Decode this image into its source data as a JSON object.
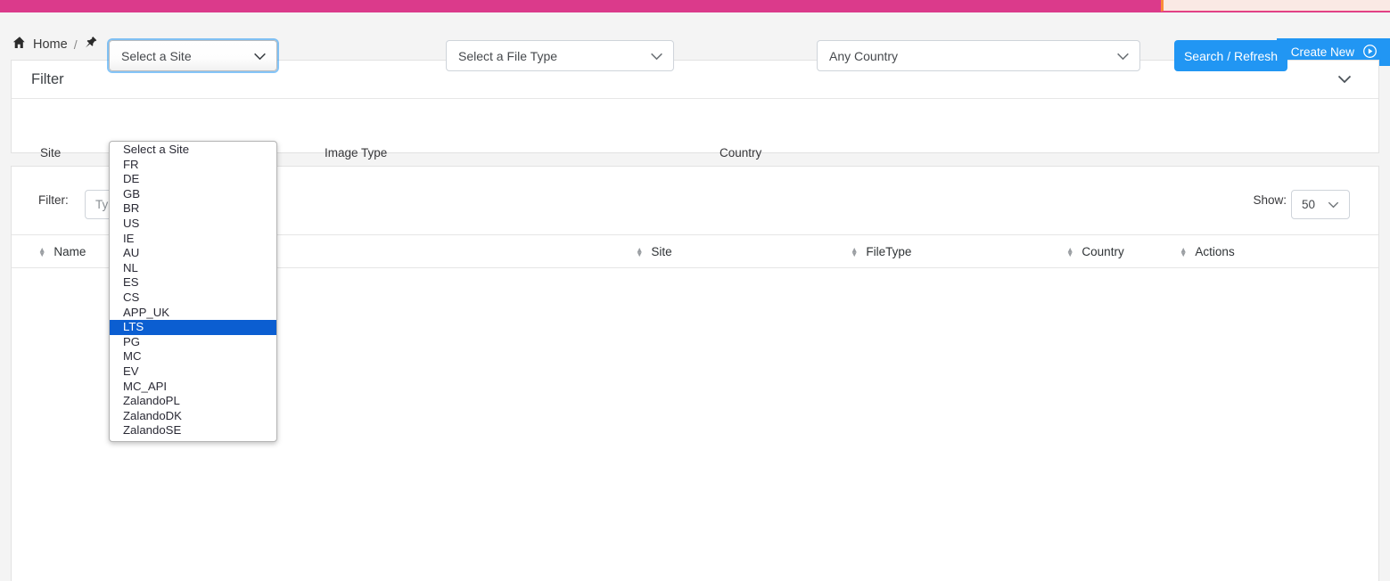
{
  "topbar": {
    "accent_color": "#db3a8b",
    "notice_color": "#fae9e4",
    "notice_border_color": "#fa8c38"
  },
  "breadcrumb": {
    "home_icon": "home-icon",
    "home_label": "Home",
    "separator": "/",
    "pin_icon": "pin-icon"
  },
  "header_actions": {
    "create_new_label": "Create New",
    "create_new_icon": "play-circle-icon",
    "create_new_color": "#2196f3"
  },
  "filter_panel": {
    "title": "Filter",
    "collapse_icon": "chevron-down-icon",
    "fields": {
      "site": {
        "label": "Site",
        "value": "Select a Site",
        "icon": "chevron-down-icon"
      },
      "image_type": {
        "label": "Image Type",
        "value": "Select a File Type",
        "icon": "chevron-down-icon"
      },
      "country": {
        "label": "Country",
        "value": "Any Country",
        "icon": "chevron-down-icon"
      }
    },
    "search_button": {
      "label": "Search / Refresh",
      "color": "#2196f3"
    }
  },
  "site_dropdown": {
    "open": true,
    "highlighted": "LTS",
    "highlight_color": "#0b5ed1",
    "options": [
      "Select a Site",
      "FR",
      "DE",
      "GB",
      "BR",
      "US",
      "IE",
      "AU",
      "NL",
      "ES",
      "CS",
      "APP_UK",
      "LTS",
      "PG",
      "MC",
      "EV",
      "MC_API",
      "ZalandoPL",
      "ZalandoDK",
      "ZalandoSE"
    ]
  },
  "table_panel": {
    "toolbar": {
      "filter_label": "Filter:",
      "filter_placeholder": "Type to filter...",
      "filter_value": "",
      "show_label": "Show:",
      "show_value": "50",
      "show_icon": "chevron-down-icon"
    },
    "columns": [
      {
        "label": "Name",
        "sort_icon": "sort-icon"
      },
      {
        "label": "Site",
        "sort_icon": "sort-icon"
      },
      {
        "label": "FileType",
        "sort_icon": "sort-icon"
      },
      {
        "label": "Country",
        "sort_icon": "sort-icon"
      },
      {
        "label": "Actions",
        "sort_icon": "sort-icon"
      }
    ],
    "rows": []
  }
}
